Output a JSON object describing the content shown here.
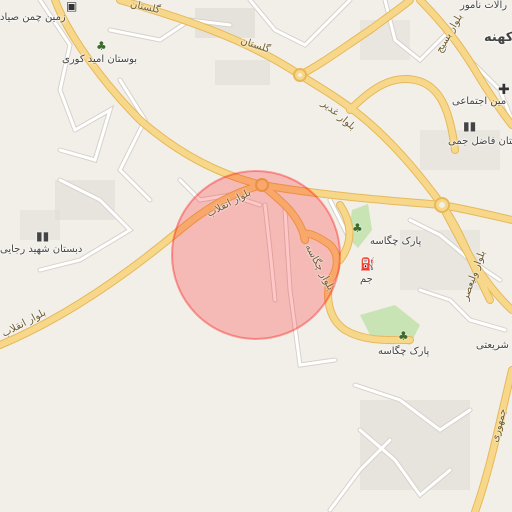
{
  "map": {
    "search_radius_color": "#ff0000",
    "major_road_color": "#f7d88a",
    "major_road_casing": "#e7b85a",
    "minor_road_color": "#ffffff",
    "minor_road_casing": "#d6d2cb",
    "park_color": "#c8e3b4",
    "building_color": "#dcd9d3"
  },
  "labels": {
    "park_omid_kouri": "بوستان امید کوری",
    "shahid_rajai_school": "دبستان شهید رجایی",
    "park_chegaseh_north": "پارک چگاسه",
    "park_chegaseh_south": "پارک چگاسه",
    "gas_station": "جم",
    "hospital_social": "مین اجتماعی",
    "fazel_school": "بیرستان فاضل جمی",
    "namour": "رالات نامور",
    "koohneh": "کهنه",
    "shariati": "شریعتی",
    "zamin_chaman": "زمین چمن صیاد"
  },
  "roads": {
    "golestan_top": "گلستان",
    "golestan_mid": "گلستان",
    "ghadir": "بلوار غدیر",
    "enghelab_north": "بلوار انقلاب",
    "enghelab_south": "بلوار انقلاب",
    "chegaseh_blvd": "بلوار چگاسه",
    "basij": "بلوار بسیج",
    "valiasr": "بلوار ولیعصر",
    "jomhouri": "جمهوری"
  },
  "icons": {
    "park": "tree-icon",
    "school": "school-icon",
    "hospital": "hospital-icon",
    "fuel": "fuel-icon"
  }
}
